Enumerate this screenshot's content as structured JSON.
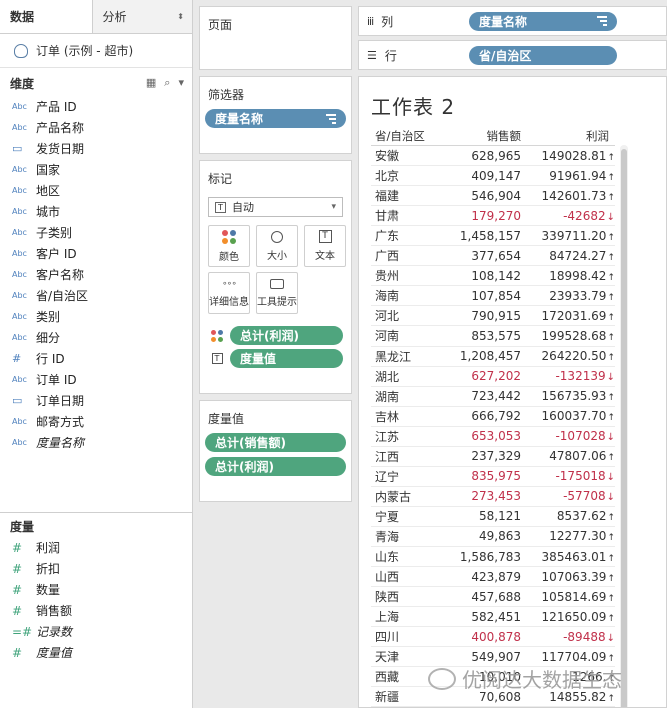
{
  "left_pane": {
    "tabs": [
      {
        "label": "数据"
      },
      {
        "label": "分析"
      }
    ],
    "datasource": "订单 (示例 - 超市)",
    "dimensions_title": "维度",
    "dimensions": [
      {
        "type": "Abc",
        "label": "产品 ID"
      },
      {
        "type": "Abc",
        "label": "产品名称"
      },
      {
        "type": "date",
        "label": "发货日期"
      },
      {
        "type": "Abc",
        "label": "国家"
      },
      {
        "type": "Abc",
        "label": "地区"
      },
      {
        "type": "Abc",
        "label": "城市"
      },
      {
        "type": "Abc",
        "label": "子类别"
      },
      {
        "type": "Abc",
        "label": "客户 ID"
      },
      {
        "type": "Abc",
        "label": "客户名称"
      },
      {
        "type": "Abc",
        "label": "省/自治区"
      },
      {
        "type": "Abc",
        "label": "类别"
      },
      {
        "type": "Abc",
        "label": "细分"
      },
      {
        "type": "#",
        "label": "行 ID"
      },
      {
        "type": "Abc",
        "label": "订单 ID"
      },
      {
        "type": "date",
        "label": "订单日期"
      },
      {
        "type": "Abc",
        "label": "邮寄方式"
      },
      {
        "type": "Abc",
        "label": "度量名称",
        "italic": true
      }
    ],
    "measures_title": "度量",
    "measures": [
      {
        "type": "#",
        "label": "利润"
      },
      {
        "type": "#",
        "label": "折扣"
      },
      {
        "type": "#",
        "label": "数量"
      },
      {
        "type": "#",
        "label": "销售额"
      },
      {
        "type": "=#",
        "label": "记录数",
        "italic": true
      },
      {
        "type": "#",
        "label": "度量值",
        "italic": true
      }
    ]
  },
  "middle": {
    "pages_title": "页面",
    "filters_title": "筛选器",
    "filter_pill": "度量名称",
    "marks_title": "标记",
    "mark_type": "自动",
    "mark_buttons": [
      "颜色",
      "大小",
      "文本",
      "详细信息",
      "工具提示"
    ],
    "mark_pills": [
      "总计(利润)",
      "度量值"
    ],
    "measure_values_title": "度量值",
    "measure_values_pills": [
      "总计(销售额)",
      "总计(利润)"
    ]
  },
  "shelves": {
    "columns_label": "列",
    "columns_pill": "度量名称",
    "rows_label": "行",
    "rows_pill": "省/自治区"
  },
  "sheet": {
    "title": "工作表 2",
    "headers": [
      "省/自治区",
      "销售额",
      "利润"
    ],
    "rows": [
      {
        "prov": "安徽",
        "sales": "628,965",
        "profit": "149028.81",
        "up": true
      },
      {
        "prov": "北京",
        "sales": "409,147",
        "profit": "91961.94",
        "up": true
      },
      {
        "prov": "福建",
        "sales": "546,904",
        "profit": "142601.73",
        "up": true
      },
      {
        "prov": "甘肃",
        "sales": "179,270",
        "profit": "-42682",
        "up": false
      },
      {
        "prov": "广东",
        "sales": "1,458,157",
        "profit": "339711.20",
        "up": true
      },
      {
        "prov": "广西",
        "sales": "377,654",
        "profit": "84724.27",
        "up": true
      },
      {
        "prov": "贵州",
        "sales": "108,142",
        "profit": "18998.42",
        "up": true
      },
      {
        "prov": "海南",
        "sales": "107,854",
        "profit": "23933.79",
        "up": true
      },
      {
        "prov": "河北",
        "sales": "790,915",
        "profit": "172031.69",
        "up": true
      },
      {
        "prov": "河南",
        "sales": "853,575",
        "profit": "199528.68",
        "up": true
      },
      {
        "prov": "黑龙江",
        "sales": "1,208,457",
        "profit": "264220.50",
        "up": true
      },
      {
        "prov": "湖北",
        "sales": "627,202",
        "profit": "-132139",
        "up": false
      },
      {
        "prov": "湖南",
        "sales": "723,442",
        "profit": "156735.93",
        "up": true
      },
      {
        "prov": "吉林",
        "sales": "666,792",
        "profit": "160037.70",
        "up": true
      },
      {
        "prov": "江苏",
        "sales": "653,053",
        "profit": "-107028",
        "up": false
      },
      {
        "prov": "江西",
        "sales": "237,329",
        "profit": "47807.06",
        "up": true
      },
      {
        "prov": "辽宁",
        "sales": "835,975",
        "profit": "-175018",
        "up": false
      },
      {
        "prov": "内蒙古",
        "sales": "273,453",
        "profit": "-57708",
        "up": false
      },
      {
        "prov": "宁夏",
        "sales": "58,121",
        "profit": "8537.62",
        "up": true
      },
      {
        "prov": "青海",
        "sales": "49,863",
        "profit": "12277.30",
        "up": true
      },
      {
        "prov": "山东",
        "sales": "1,586,783",
        "profit": "385463.01",
        "up": true
      },
      {
        "prov": "山西",
        "sales": "423,879",
        "profit": "107063.39",
        "up": true
      },
      {
        "prov": "陕西",
        "sales": "457,688",
        "profit": "105814.69",
        "up": true
      },
      {
        "prov": "上海",
        "sales": "582,451",
        "profit": "121650.09",
        "up": true
      },
      {
        "prov": "四川",
        "sales": "400,878",
        "profit": "-89488",
        "up": false
      },
      {
        "prov": "天津",
        "sales": "549,907",
        "profit": "117704.09",
        "up": true
      },
      {
        "prov": "西藏",
        "sales": "10,010",
        "profit": "1266.",
        "up": true
      },
      {
        "prov": "新疆",
        "sales": "70,608",
        "profit": "14855.82",
        "up": true
      }
    ]
  },
  "watermark": "优阅达大数据生态",
  "colors": {
    "blue_pill": "#5b8eb3",
    "green_pill": "#4fa57e",
    "negative": "#c0304a"
  }
}
